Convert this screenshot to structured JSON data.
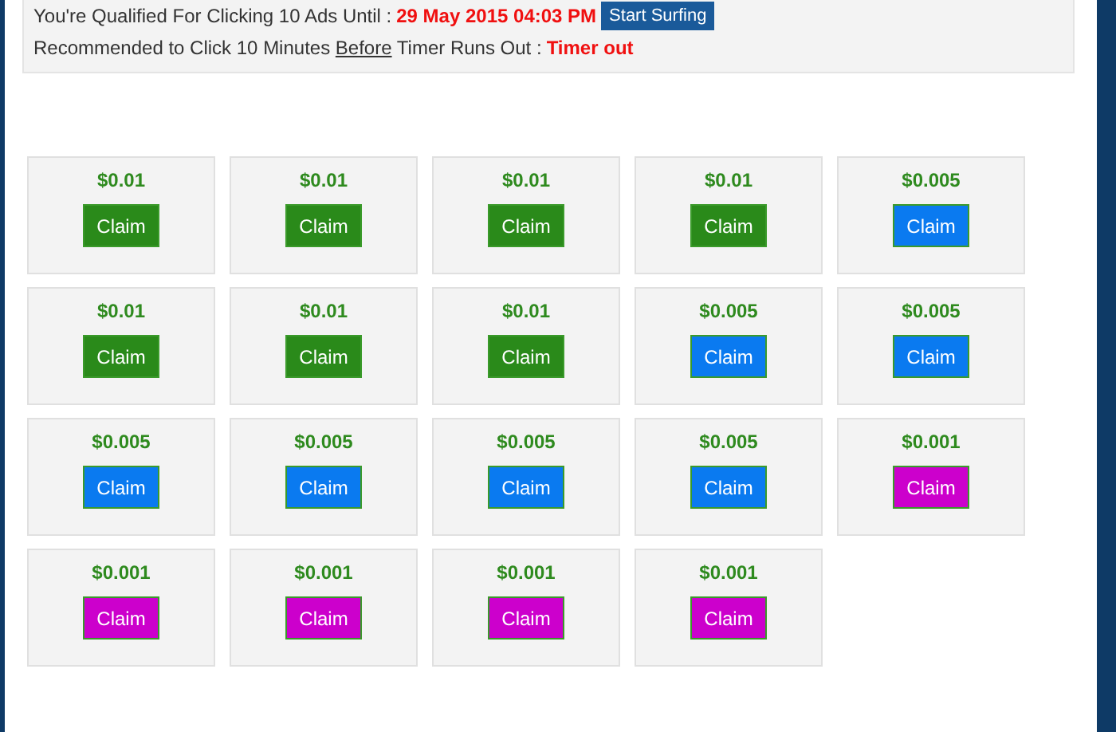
{
  "info": {
    "qualified_label": "You're Qualified For Clicking 10 Ads Until :",
    "qualified_until": "29 May 2015 04:03 PM",
    "start_button": "Start Surfing",
    "recommend_before": "Recommended to Click 10 Minutes ",
    "recommend_underlined": "Before",
    "recommend_after": " Timer Runs Out :",
    "timer": "Timer out"
  },
  "ads": [
    {
      "amount": "$0.01",
      "button": "Claim",
      "color": "#2a8a1a"
    },
    {
      "amount": "$0.01",
      "button": "Claim",
      "color": "#2a8a1a"
    },
    {
      "amount": "$0.01",
      "button": "Claim",
      "color": "#2a8a1a"
    },
    {
      "amount": "$0.01",
      "button": "Claim",
      "color": "#2a8a1a"
    },
    {
      "amount": "$0.005",
      "button": "Claim",
      "color": "#0a7af0"
    },
    {
      "amount": "$0.01",
      "button": "Claim",
      "color": "#2a8a1a"
    },
    {
      "amount": "$0.01",
      "button": "Claim",
      "color": "#2a8a1a"
    },
    {
      "amount": "$0.01",
      "button": "Claim",
      "color": "#2a8a1a"
    },
    {
      "amount": "$0.005",
      "button": "Claim",
      "color": "#0a7af0"
    },
    {
      "amount": "$0.005",
      "button": "Claim",
      "color": "#0a7af0"
    },
    {
      "amount": "$0.005",
      "button": "Claim",
      "color": "#0a7af0"
    },
    {
      "amount": "$0.005",
      "button": "Claim",
      "color": "#0a7af0"
    },
    {
      "amount": "$0.005",
      "button": "Claim",
      "color": "#0a7af0"
    },
    {
      "amount": "$0.005",
      "button": "Claim",
      "color": "#0a7af0"
    },
    {
      "amount": "$0.001",
      "button": "Claim",
      "color": "#cc00cc"
    },
    {
      "amount": "$0.001",
      "button": "Claim",
      "color": "#cc00cc"
    },
    {
      "amount": "$0.001",
      "button": "Claim",
      "color": "#cc00cc"
    },
    {
      "amount": "$0.001",
      "button": "Claim",
      "color": "#cc00cc"
    },
    {
      "amount": "$0.001",
      "button": "Claim",
      "color": "#cc00cc"
    }
  ]
}
